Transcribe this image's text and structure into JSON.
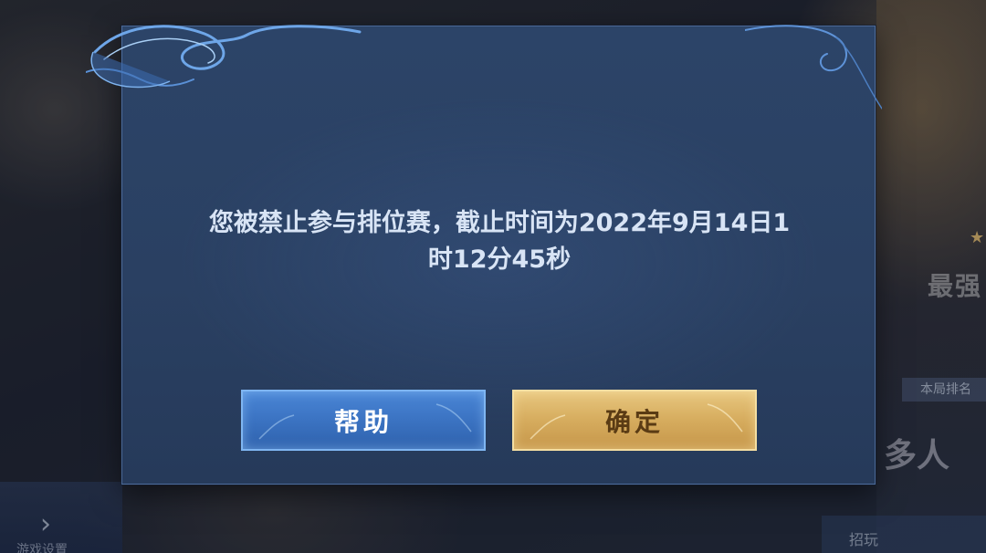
{
  "dialog": {
    "message_line1": "您被禁止参与排位赛，截止时间为2022年9月14日1",
    "message_line2": "时12分45秒",
    "help_button": "帮助",
    "confirm_button": "确定"
  },
  "background": {
    "right_title": "最强",
    "right_sub": "本局排名",
    "right_many": "多人",
    "bottom_right_label": "招玩",
    "left_label": "游戏设置"
  },
  "colors": {
    "dialog_bg": "#2a4062",
    "message_text": "#d8e4f5",
    "help_button": "#3b73c2",
    "confirm_button": "#d6ac5e"
  }
}
